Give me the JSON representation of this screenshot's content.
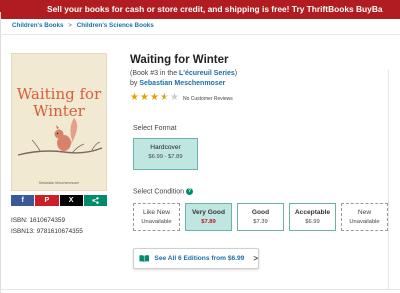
{
  "promo": {
    "text": "Sell your books for cash or store credit, and shipping is free! Try ThriftBooks BuyBa"
  },
  "breadcrumb": {
    "items": [
      "Children's Books",
      "Children's Science Books"
    ],
    "separator": ">"
  },
  "book": {
    "title": "Waiting for Winter",
    "series_prefix": "(Book #3 in the ",
    "series_name": "L'écureuil Series",
    "series_suffix": ")",
    "author_prefix": "by ",
    "author": "Sebastian Meschenmoser",
    "rating": 3.5,
    "reviews_text": "No Customer Reviews",
    "cover": {
      "title_line1": "Waiting for",
      "title_line2": "Winter",
      "author": "Sebastian Meschenmoser",
      "title_color": "#d85e3b"
    },
    "isbn_label": "ISBN:",
    "isbn": "1610674359",
    "isbn13_label": "ISBN13:",
    "isbn13": "9781610674355"
  },
  "share": {
    "facebook": "f",
    "pinterest": "P",
    "x": "X",
    "share": "<"
  },
  "format": {
    "label": "Select Format",
    "options": [
      {
        "title": "Hardcover",
        "price": "$6.99 - $7.89",
        "selected": true
      }
    ]
  },
  "condition": {
    "label": "Select Condition",
    "help": "?",
    "options": [
      {
        "title": "Like New",
        "price": "Unavailable",
        "state": "unavailable"
      },
      {
        "title": "Very Good",
        "price": "$7.89",
        "state": "selected"
      },
      {
        "title": "Good",
        "price": "$7.39",
        "state": "available"
      },
      {
        "title": "Acceptable",
        "price": "$6.99",
        "state": "available"
      },
      {
        "title": "New",
        "price": "Unavailable",
        "state": "unavailable"
      }
    ]
  },
  "editions": {
    "label": "See All 6 Editions from $6.99",
    "chevron": ">"
  },
  "colors": {
    "promo_bg": "#b11c21",
    "link": "#1a6fa8",
    "accent_green": "#008c6a",
    "selected_bg": "#bfe6e0",
    "star": "#e5a100",
    "price_red": "#c4161c"
  }
}
